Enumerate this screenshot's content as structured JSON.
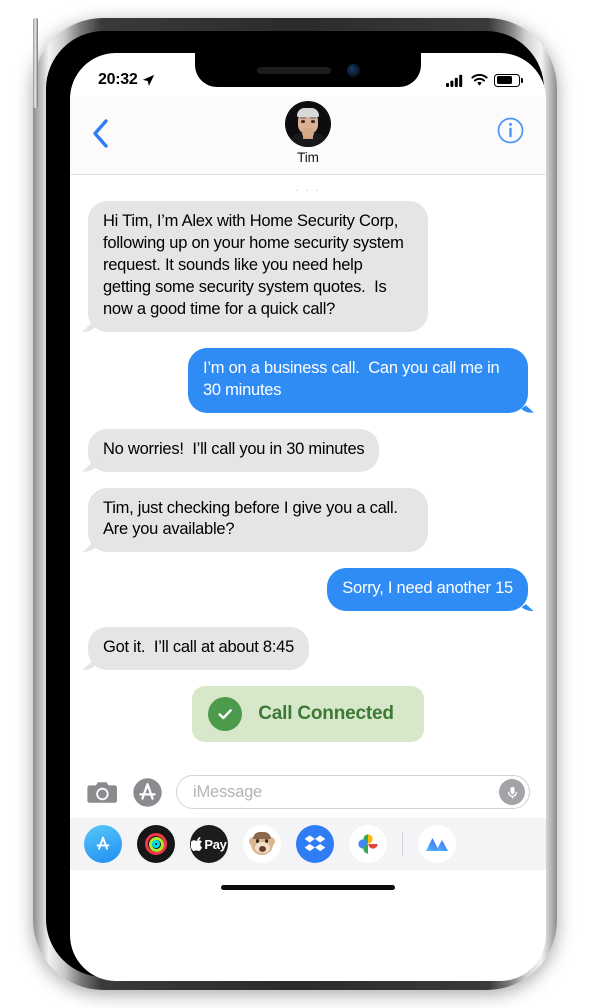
{
  "status_bar": {
    "time": "20:32",
    "location_icon": "location-arrow-icon",
    "signal_icon": "cellular-signal-icon",
    "wifi_icon": "wifi-icon",
    "battery_icon": "battery-icon",
    "battery_level_pct": 72
  },
  "nav_bar": {
    "back_icon": "chevron-left-icon",
    "info_icon": "info-circle-icon",
    "contact_name": "Tim",
    "avatar_icon": "contact-avatar"
  },
  "conversation": {
    "timestamp_fragment": "· · ·",
    "messages": [
      {
        "id": "msg-1",
        "direction": "incoming",
        "text": "Hi Tim, I’m Alex with Home Security Corp, following up on your home security system request. It sounds like you need help getting some security system quotes.  Is now a good time for a quick call?"
      },
      {
        "id": "msg-2",
        "direction": "outgoing",
        "text": "I’m on a business call.  Can you call me in 30 minutes"
      },
      {
        "id": "msg-3",
        "direction": "incoming",
        "text": "No worries!  I’ll call you in 30 minutes"
      },
      {
        "id": "msg-4",
        "direction": "incoming",
        "text": "Tim, just checking before I give you a call.  Are you available?"
      },
      {
        "id": "msg-5",
        "direction": "outgoing",
        "text": "Sorry, I need another 15"
      },
      {
        "id": "msg-6",
        "direction": "incoming",
        "text": "Got it.  I’ll call at about 8:45"
      }
    ],
    "call_status": {
      "label": "Call Connected",
      "icon": "check-circle-icon",
      "background_color": "#d6e8c9",
      "check_color": "#4c9a4c",
      "text_color": "#3c7a36"
    }
  },
  "input_bar": {
    "camera_icon": "camera-icon",
    "appstore_icon": "app-store-icon",
    "message_value": "",
    "message_placeholder": "iMessage",
    "mic_icon": "microphone-icon"
  },
  "app_drawer": {
    "apps": [
      {
        "id": "app-store",
        "icon": "app-store-icon",
        "color": "#3fa9f5"
      },
      {
        "id": "activity",
        "icon": "activity-rings-icon",
        "color": "#161616"
      },
      {
        "id": "apple-pay",
        "icon": "apple-pay-icon",
        "color": "#1c1c1c",
        "label": "Pay"
      },
      {
        "id": "memoji",
        "icon": "memoji-monkey-icon",
        "color": "#ffffff"
      },
      {
        "id": "dropbox",
        "icon": "dropbox-icon",
        "color": "#2f7df5"
      },
      {
        "id": "google-photos",
        "icon": "google-photos-icon",
        "color": "#ffffff"
      },
      {
        "id": "partial-app",
        "icon": "gradient-mountain-icon",
        "color": "#ffffff"
      }
    ]
  },
  "theme": {
    "bubble_incoming": "#e5e5e5",
    "bubble_outgoing": "#2f8cf5",
    "accent_blue": "#2f8cf5",
    "nav_background": "#fbfbfb",
    "drawer_background": "#f4f4f6"
  },
  "device": {
    "notch_speaker": "earpiece-speaker",
    "notch_camera": "front-camera-icon",
    "home_indicator": "home-indicator"
  }
}
